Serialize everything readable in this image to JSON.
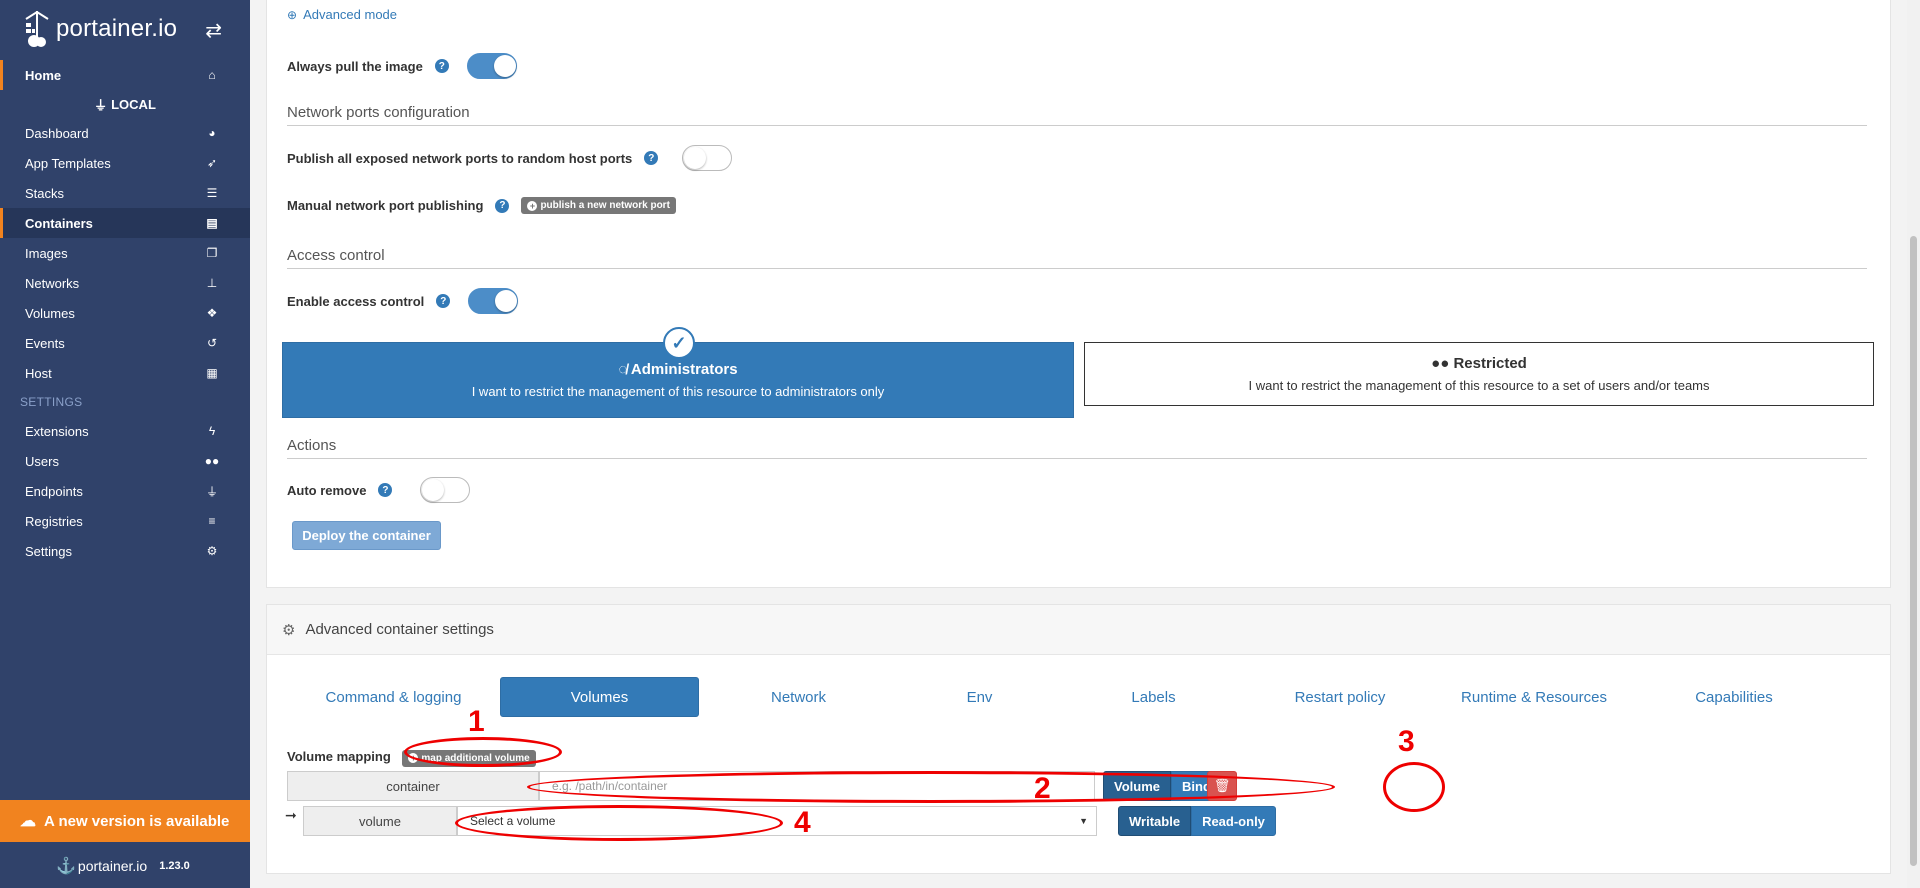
{
  "brand": {
    "name": "portainer.io",
    "version": "1.23.0"
  },
  "sidebar": {
    "home": "Home",
    "environment": "LOCAL",
    "items": [
      {
        "label": "Dashboard",
        "icon": "tachometer-icon"
      },
      {
        "label": "App Templates",
        "icon": "rocket-icon"
      },
      {
        "label": "Stacks",
        "icon": "list-icon"
      },
      {
        "label": "Containers",
        "icon": "server-icon"
      },
      {
        "label": "Images",
        "icon": "clone-icon"
      },
      {
        "label": "Networks",
        "icon": "sitemap-icon"
      },
      {
        "label": "Volumes",
        "icon": "cubes-icon"
      },
      {
        "label": "Events",
        "icon": "history-icon"
      },
      {
        "label": "Host",
        "icon": "th-icon"
      }
    ],
    "settings_title": "SETTINGS",
    "settings_items": [
      {
        "label": "Extensions",
        "icon": "bolt-icon"
      },
      {
        "label": "Users",
        "icon": "users-icon"
      },
      {
        "label": "Endpoints",
        "icon": "plug-icon"
      },
      {
        "label": "Registries",
        "icon": "database-icon"
      },
      {
        "label": "Settings",
        "icon": "cogs-icon"
      }
    ],
    "update_banner": "A new version is available"
  },
  "form": {
    "advanced_mode": "Advanced mode",
    "always_pull": "Always pull the image",
    "always_pull_on": true,
    "network_ports_title": "Network ports configuration",
    "publish_all": "Publish all exposed network ports to random host ports",
    "publish_all_on": false,
    "manual_publish": "Manual network port publishing",
    "publish_new_port": "publish a new network port",
    "access_control_title": "Access control",
    "enable_access_control": "Enable access control",
    "enable_access_control_on": true,
    "admin_title": "Administrators",
    "admin_desc": "I want to restrict the management of this resource to administrators only",
    "restricted_title": "Restricted",
    "restricted_desc": "I want to restrict the management of this resource to a set of users and/or teams",
    "actions_title": "Actions",
    "auto_remove": "Auto remove",
    "auto_remove_on": false,
    "deploy": "Deploy the container"
  },
  "advanced": {
    "title": "Advanced container settings",
    "tabs": [
      "Command & logging",
      "Volumes",
      "Network",
      "Env",
      "Labels",
      "Restart policy",
      "Runtime & Resources",
      "Capabilities"
    ],
    "active_tab": "Volumes",
    "volume_mapping": "Volume mapping",
    "map_additional": "map additional volume",
    "container_addon": "container",
    "container_placeholder": "e.g. /path/in/container",
    "volume_btn": "Volume",
    "bind_btn": "Bind",
    "volume_addon": "volume",
    "select_volume": "Select a volume",
    "writable": "Writable",
    "readonly": "Read-only"
  },
  "annotations": [
    "1",
    "2",
    "3",
    "4"
  ],
  "colors": {
    "sidebar": "#30426a",
    "accent": "#f1831f",
    "primary": "#337ab7",
    "annotation": "#e00000"
  }
}
